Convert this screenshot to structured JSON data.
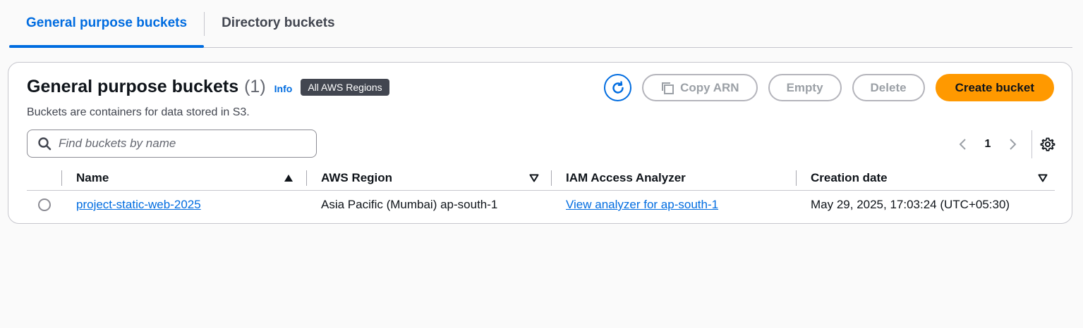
{
  "tabs": [
    {
      "label": "General purpose buckets",
      "active": true
    },
    {
      "label": "Directory buckets",
      "active": false
    }
  ],
  "panel": {
    "title": "General purpose buckets",
    "count": "(1)",
    "info_label": "Info",
    "region_badge": "All AWS Regions",
    "description": "Buckets are containers for data stored in S3."
  },
  "actions": {
    "refresh_icon": "refresh-icon",
    "copy_arn_label": "Copy ARN",
    "copy_icon": "copy-icon",
    "empty_label": "Empty",
    "delete_label": "Delete",
    "create_label": "Create bucket"
  },
  "search": {
    "placeholder": "Find buckets by name",
    "value": ""
  },
  "pagination": {
    "current_page": "1"
  },
  "table": {
    "columns": [
      "Name",
      "AWS Region",
      "IAM Access Analyzer",
      "Creation date"
    ],
    "rows": [
      {
        "name": "project-static-web-2025",
        "region": "Asia Pacific (Mumbai) ap-south-1",
        "analyzer": "View analyzer for ap-south-1",
        "created": "May 29, 2025, 17:03:24 (UTC+05:30)"
      }
    ]
  },
  "colors": {
    "accent": "#006ce0",
    "primary_button": "#ff9900",
    "badge_bg": "#424650"
  }
}
